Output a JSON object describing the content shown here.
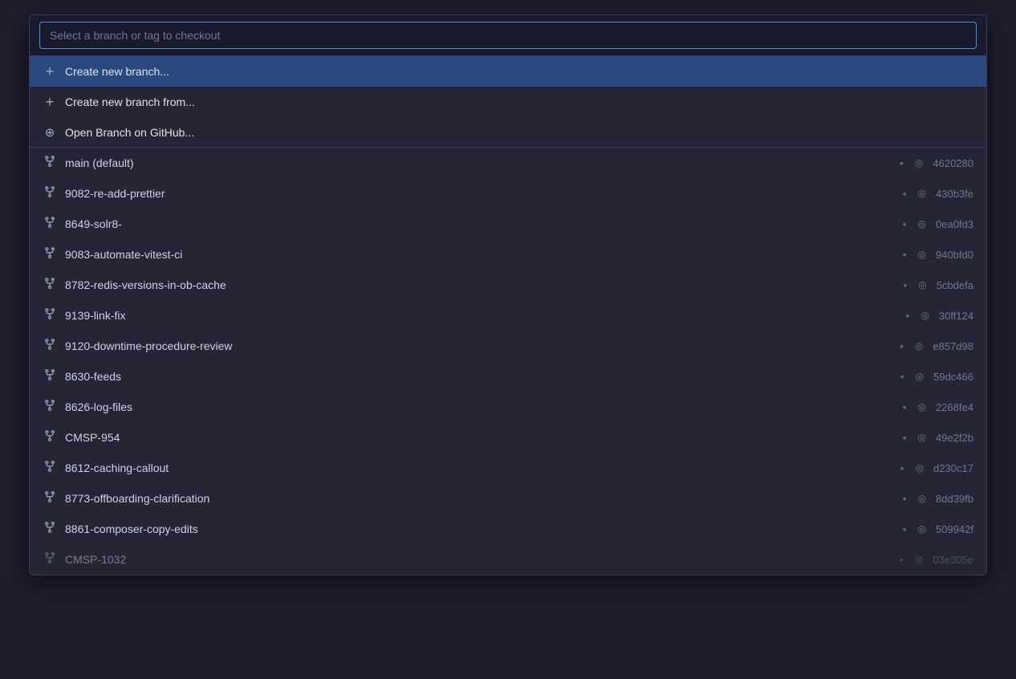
{
  "search": {
    "placeholder": "Select a branch or tag to checkout",
    "value": ""
  },
  "actions": [
    {
      "id": "create-new-branch",
      "icon": "plus",
      "label": "Create new branch...",
      "active": true,
      "divider_below": false
    },
    {
      "id": "create-new-branch-from",
      "icon": "plus",
      "label": "Create new branch from...",
      "active": false,
      "divider_below": false
    },
    {
      "id": "open-branch-github",
      "icon": "globe",
      "label": "Open Branch on GitHub...",
      "active": false,
      "divider_below": true
    }
  ],
  "branches": [
    {
      "name": "main (default)",
      "hash": "4620280"
    },
    {
      "name": "9082-re-add-prettier",
      "hash": "430b3fe"
    },
    {
      "name": "8649-solr8-",
      "hash": "0ea0fd3"
    },
    {
      "name": "9083-automate-vitest-ci",
      "hash": "940bfd0"
    },
    {
      "name": "8782-redis-versions-in-ob-cache",
      "hash": "5cbdefa"
    },
    {
      "name": "9139-link-fix",
      "hash": "30ff124"
    },
    {
      "name": "9120-downtime-procedure-review",
      "hash": "e857d98"
    },
    {
      "name": "8630-feeds",
      "hash": "59dc466"
    },
    {
      "name": "8626-log-files",
      "hash": "2268fe4"
    },
    {
      "name": "CMSP-954",
      "hash": "49e2f2b"
    },
    {
      "name": "8612-caching-callout",
      "hash": "d230c17"
    },
    {
      "name": "8773-offboarding-clarification",
      "hash": "8dd39fb"
    },
    {
      "name": "8861-composer-copy-edits",
      "hash": "509942f"
    },
    {
      "name": "CMSP-1032",
      "hash": "03e305e",
      "faded": true
    }
  ],
  "icons": {
    "plus": "+",
    "globe": "⊕",
    "branch": "⎇",
    "commit": "◎"
  },
  "colors": {
    "active_bg": "#2a4a7f",
    "hover_bg": "#2e2e4e",
    "border": "#3a3a5c",
    "text_primary": "#d0d0e8",
    "text_muted": "#6a7a8a",
    "accent_blue": "#4a90d9"
  }
}
